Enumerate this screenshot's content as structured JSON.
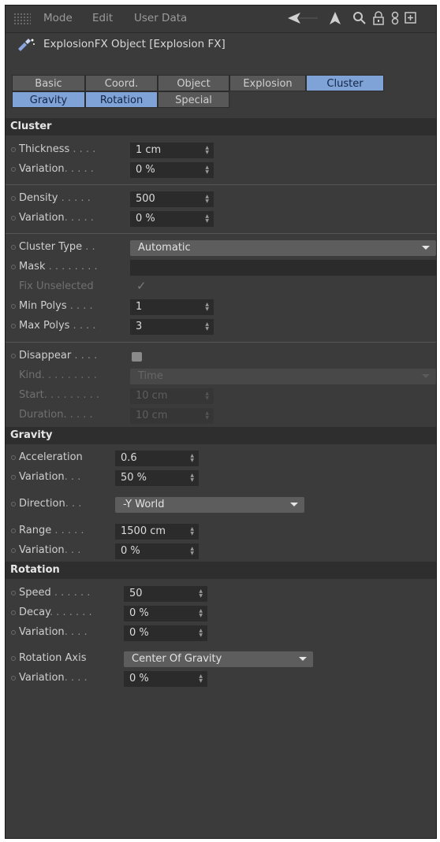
{
  "menubar": {
    "items": [
      "Mode",
      "Edit",
      "User Data"
    ],
    "icons": [
      "back-arrow-icon",
      "cursor-arrow-icon",
      "search-icon",
      "lock-icon",
      "link-icon",
      "new-panel-icon"
    ]
  },
  "object": {
    "title": "ExplosionFX Object [Explosion FX]",
    "icon": "explosionfx-icon"
  },
  "tabs": {
    "row1": [
      {
        "label": "Basic",
        "active": false
      },
      {
        "label": "Coord.",
        "active": false
      },
      {
        "label": "Object",
        "active": false
      },
      {
        "label": "Explosion",
        "active": false
      },
      {
        "label": "Cluster",
        "active": true
      }
    ],
    "row2": [
      {
        "label": "Gravity",
        "active": true
      },
      {
        "label": "Rotation",
        "active": true
      },
      {
        "label": "Special",
        "active": false
      }
    ]
  },
  "cluster": {
    "header": "Cluster",
    "thickness": {
      "label": "Thickness",
      "dots": " . . . .",
      "value": "1 cm"
    },
    "thickness_variation": {
      "label": "Variation",
      "dots": ". . . . .",
      "value": "0 %"
    },
    "density": {
      "label": "Density",
      "dots": " . . . . .",
      "value": "500"
    },
    "density_variation": {
      "label": "Variation",
      "dots": ". . . . .",
      "value": "0 %"
    },
    "cluster_type": {
      "label": "Cluster Type",
      "dots": " . .",
      "value": "Automatic"
    },
    "mask": {
      "label": "Mask",
      "dots": " . . . . . . . ."
    },
    "fix_unselected": {
      "label": "Fix Unselected",
      "checked": true
    },
    "min_polys": {
      "label": "Min Polys",
      "dots": " . . . .",
      "value": "1"
    },
    "max_polys": {
      "label": "Max Polys",
      "dots": " . . . .",
      "value": "3"
    },
    "disappear": {
      "label": "Disappear",
      "dots": " . . . .",
      "checked": false
    },
    "kind": {
      "label": "Kind",
      "dots": ". . . . . . . . .",
      "value": "Time"
    },
    "start": {
      "label": "Start",
      "dots": ". . . . . . . . .",
      "value": "10 cm"
    },
    "duration": {
      "label": "Duration",
      "dots": ". . . . .",
      "value": "10 cm"
    }
  },
  "gravity": {
    "header": "Gravity",
    "acceleration": {
      "label": "Acceleration",
      "dots": "",
      "value": "0.6"
    },
    "variation": {
      "label": "Variation",
      "dots": ". . .",
      "value": "50 %"
    },
    "direction": {
      "label": "Direction",
      "dots": ". . .",
      "value": "-Y World"
    },
    "range": {
      "label": "Range",
      "dots": " . . . . .",
      "value": "1500 cm"
    },
    "range_variation": {
      "label": "Variation",
      "dots": ". . .",
      "value": "0 %"
    }
  },
  "rotation": {
    "header": "Rotation",
    "speed": {
      "label": "Speed",
      "dots": " . . . . . .",
      "value": "50"
    },
    "decay": {
      "label": "Decay",
      "dots": ". . . . . . .",
      "value": "0 %"
    },
    "variation": {
      "label": "Variation",
      "dots": ". . . .",
      "value": "0 %"
    },
    "rotation_axis": {
      "label": "Rotation Axis",
      "dots": "",
      "value": "Center Of Gravity"
    },
    "axis_variation": {
      "label": "Variation",
      "dots": ". . . .",
      "value": "0 %"
    }
  },
  "colors": {
    "panel": "#3b3b3b",
    "header": "#2e2e2e",
    "field": "#2b2b2b",
    "tab_active": "#7fa3d6",
    "dropdown": "#5d5d5d"
  }
}
